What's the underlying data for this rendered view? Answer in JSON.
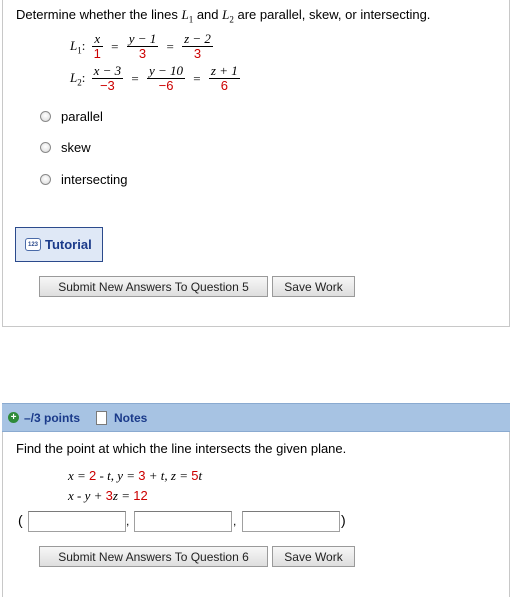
{
  "q5": {
    "prompt_a": "Determine whether the lines ",
    "prompt_b": " and ",
    "prompt_c": " are parallel, skew, or intersecting.",
    "L": "L",
    "sub1": "1",
    "sub2": "2",
    "colon": ":",
    "eq": "=",
    "line1": {
      "n1": "x",
      "d1": "1",
      "n2": "y − 1",
      "d2": "3",
      "n3": "z − 2",
      "d3": "3"
    },
    "line2": {
      "n1": "x − 3",
      "d1": "−3",
      "n2": "y − 10",
      "d2": "−6",
      "n3": "z + 1",
      "d3": "6"
    },
    "options": [
      "parallel",
      "skew",
      "intersecting"
    ],
    "tutorial_label": "Tutorial",
    "tutorial_icon_text": "123",
    "submit_label": "Submit New Answers To Question 5",
    "save_label": "Save Work"
  },
  "q6": {
    "points_label": "–/3 points",
    "notes_label": "Notes",
    "prompt": "Find the point at which the line intersects the given plane.",
    "eq1": {
      "x_lhs": "x = ",
      "x_val": "2",
      "x_rest": " - t,   y = ",
      "y_val": "3",
      "y_rest": " + t,   z = ",
      "z_val": "5",
      "z_rest": "t"
    },
    "eq2": {
      "lhs": "x - y + ",
      "coef": "3",
      "rest": "z = ",
      "rhs": "12"
    },
    "open_paren": "(",
    "close_paren": ")",
    "comma": ",",
    "answer_values": [
      "",
      "",
      ""
    ],
    "submit_label": "Submit New Answers To Question 6",
    "save_label": "Save Work"
  },
  "colors": {
    "accent_red": "#cc0000",
    "bar_blue": "#a7c3e3",
    "link_blue": "#1a3a8a",
    "plus_green": "#2e8b3a"
  }
}
